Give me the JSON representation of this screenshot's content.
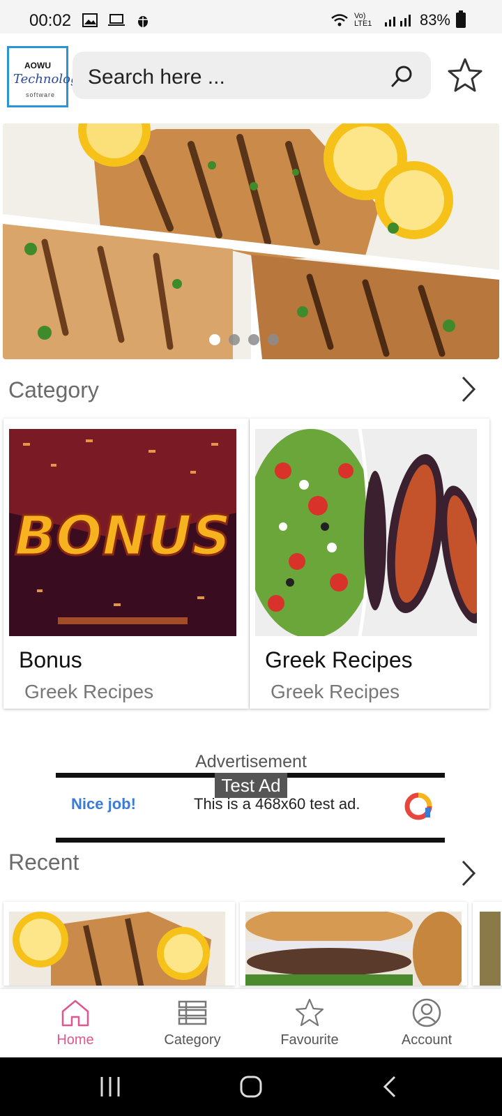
{
  "status_bar": {
    "time": "00:02",
    "network": "Vo) LTE1",
    "battery": "83%"
  },
  "header": {
    "logo_line1": "AOWU",
    "logo_line2": "Technology",
    "logo_line3": "software",
    "search_placeholder": "Search here ..."
  },
  "banner": {
    "slides": 4,
    "active_slide": 1
  },
  "category": {
    "title": "Category",
    "cards": [
      {
        "title": "Bonus",
        "subtitle": "Greek Recipes",
        "image_text": "BONUS"
      },
      {
        "title": "Greek Recipes",
        "subtitle": "Greek Recipes"
      }
    ]
  },
  "ad": {
    "label": "Advertisement",
    "tag": "Test Ad",
    "headline": "Nice job!",
    "text": "This is a 468x60 test ad."
  },
  "recent": {
    "title": "Recent"
  },
  "bottom_nav": {
    "items": [
      {
        "label": "Home",
        "icon": "home-icon",
        "active": true
      },
      {
        "label": "Category",
        "icon": "list-icon",
        "active": false
      },
      {
        "label": "Favourite",
        "icon": "star-icon",
        "active": false
      },
      {
        "label": "Account",
        "icon": "account-icon",
        "active": false
      }
    ]
  },
  "colors": {
    "accent": "#e0568f",
    "logo_border": "#2a94d6",
    "ad_link": "#3a7bd5"
  }
}
